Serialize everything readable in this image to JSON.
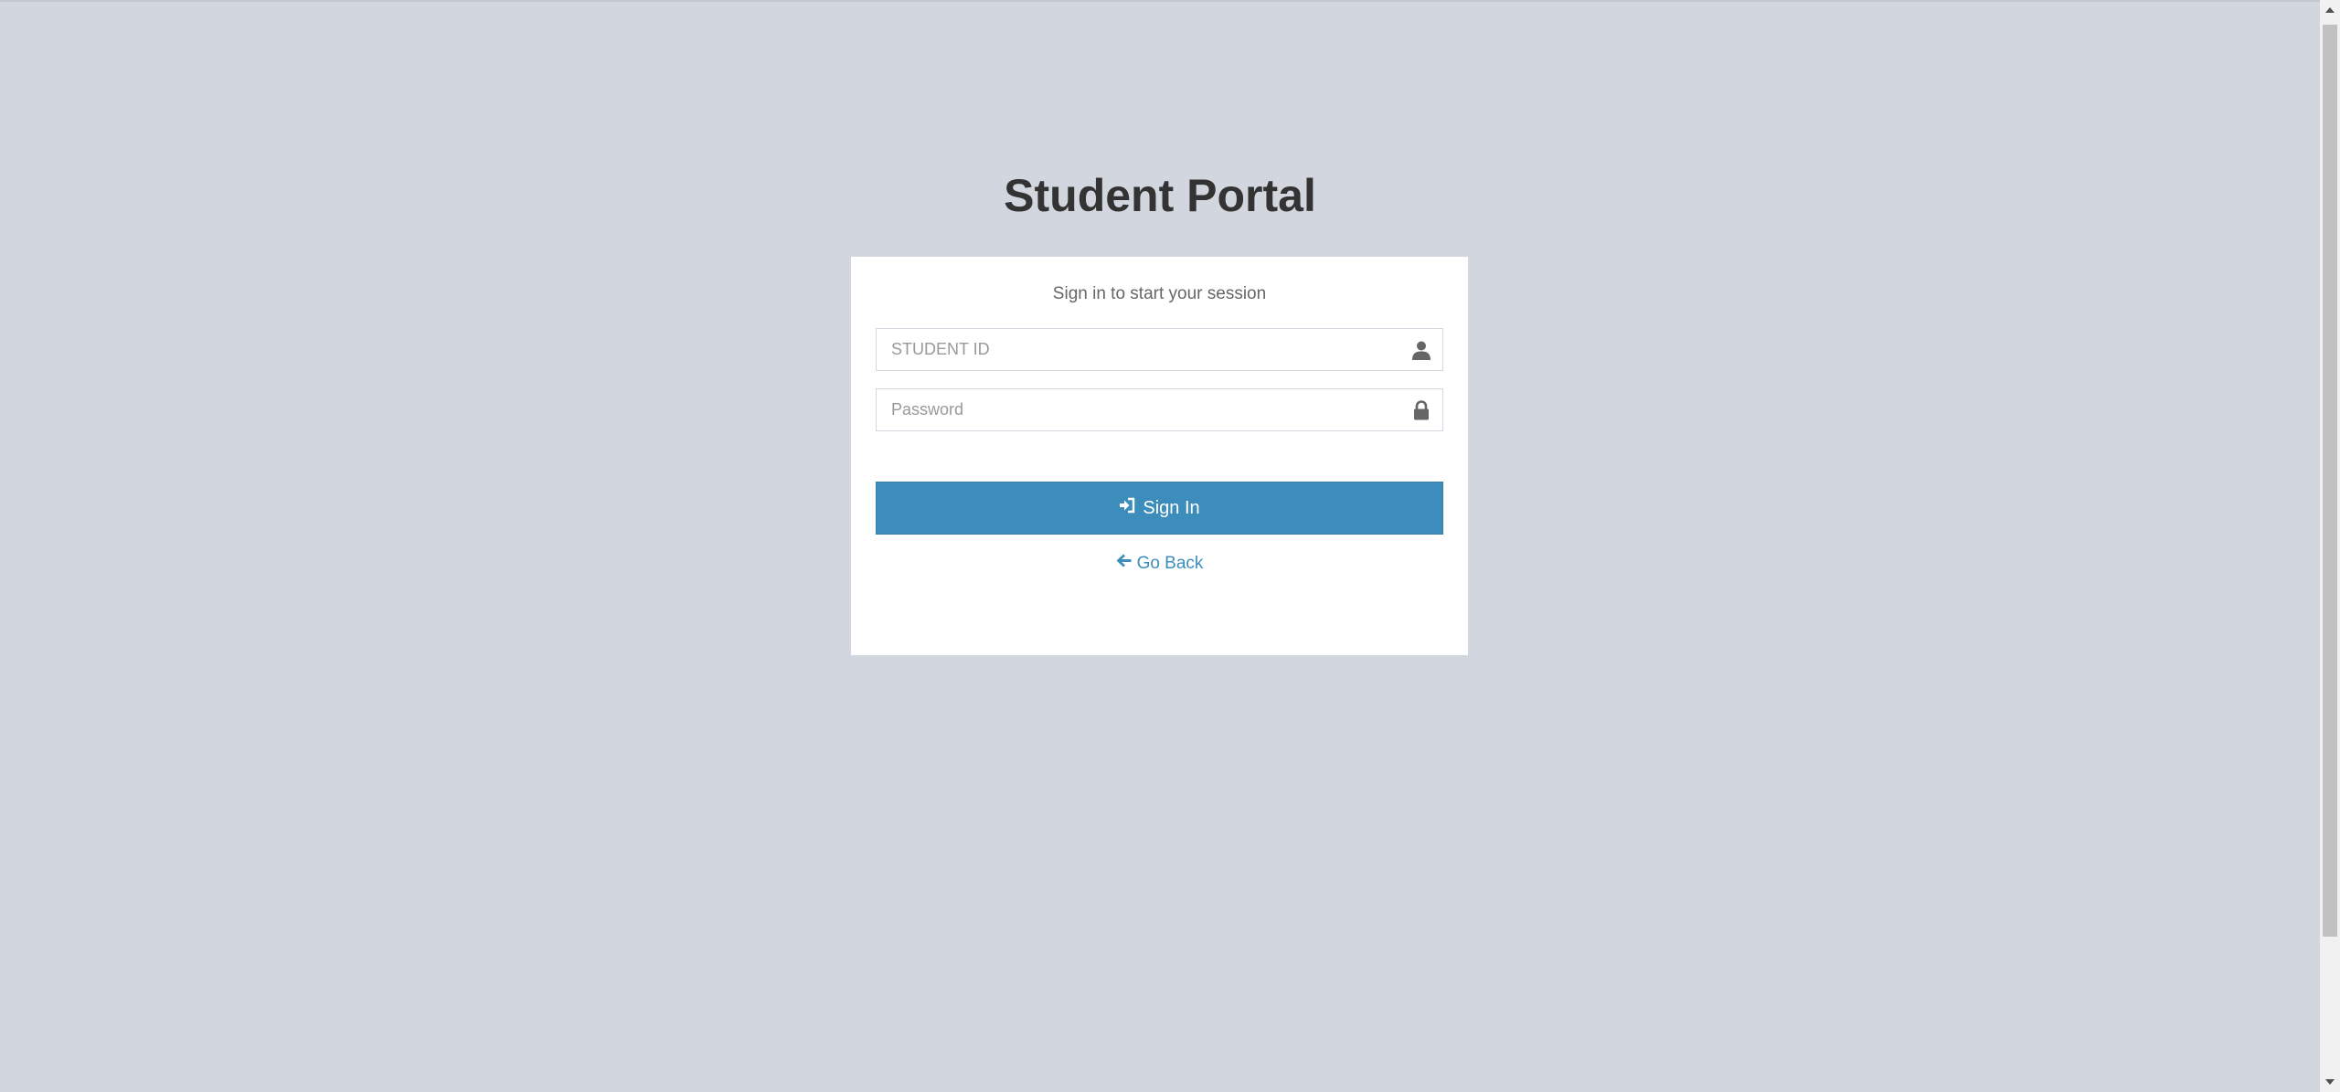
{
  "logo": {
    "title": "Student Portal"
  },
  "login": {
    "message": "Sign in to start your session",
    "student_id": {
      "placeholder": "STUDENT ID",
      "value": "",
      "icon": "user-icon"
    },
    "password": {
      "placeholder": "Password",
      "value": "",
      "icon": "lock-icon"
    },
    "signin_label": "Sign In",
    "signin_icon": "sign-in-icon",
    "go_back_label": "Go Back",
    "go_back_icon": "arrow-left-icon"
  },
  "colors": {
    "background": "#d2d6de",
    "primary": "#3c8dbc",
    "box": "#ffffff",
    "title_text": "#333333"
  }
}
